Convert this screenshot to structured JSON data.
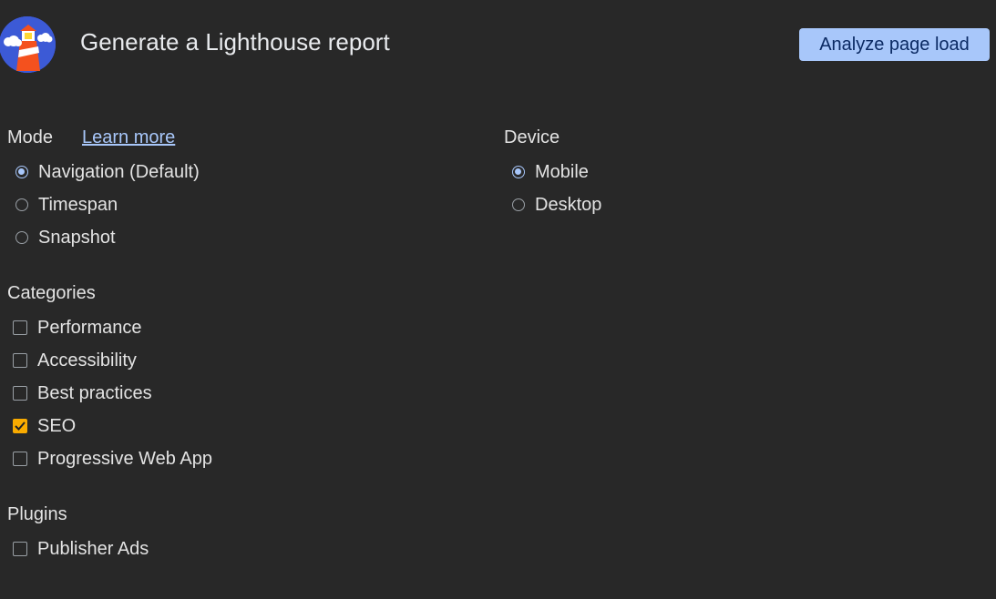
{
  "header": {
    "title": "Generate a Lighthouse report",
    "analyze_button": "Analyze page load",
    "logo_icon": "lighthouse-logo-icon"
  },
  "mode": {
    "heading": "Mode",
    "learn_more": "Learn more",
    "options": [
      {
        "label": "Navigation (Default)",
        "checked": true
      },
      {
        "label": "Timespan",
        "checked": false
      },
      {
        "label": "Snapshot",
        "checked": false
      }
    ]
  },
  "device": {
    "heading": "Device",
    "options": [
      {
        "label": "Mobile",
        "checked": true
      },
      {
        "label": "Desktop",
        "checked": false
      }
    ]
  },
  "categories": {
    "heading": "Categories",
    "items": [
      {
        "label": "Performance",
        "checked": false
      },
      {
        "label": "Accessibility",
        "checked": false
      },
      {
        "label": "Best practices",
        "checked": false
      },
      {
        "label": "SEO",
        "checked": true
      },
      {
        "label": "Progressive Web App",
        "checked": false
      }
    ]
  },
  "plugins": {
    "heading": "Plugins",
    "items": [
      {
        "label": "Publisher Ads",
        "checked": false
      }
    ]
  },
  "colors": {
    "background": "#282828",
    "accent": "#a8c7fa",
    "checkbox_checked": "#f9ab00"
  }
}
